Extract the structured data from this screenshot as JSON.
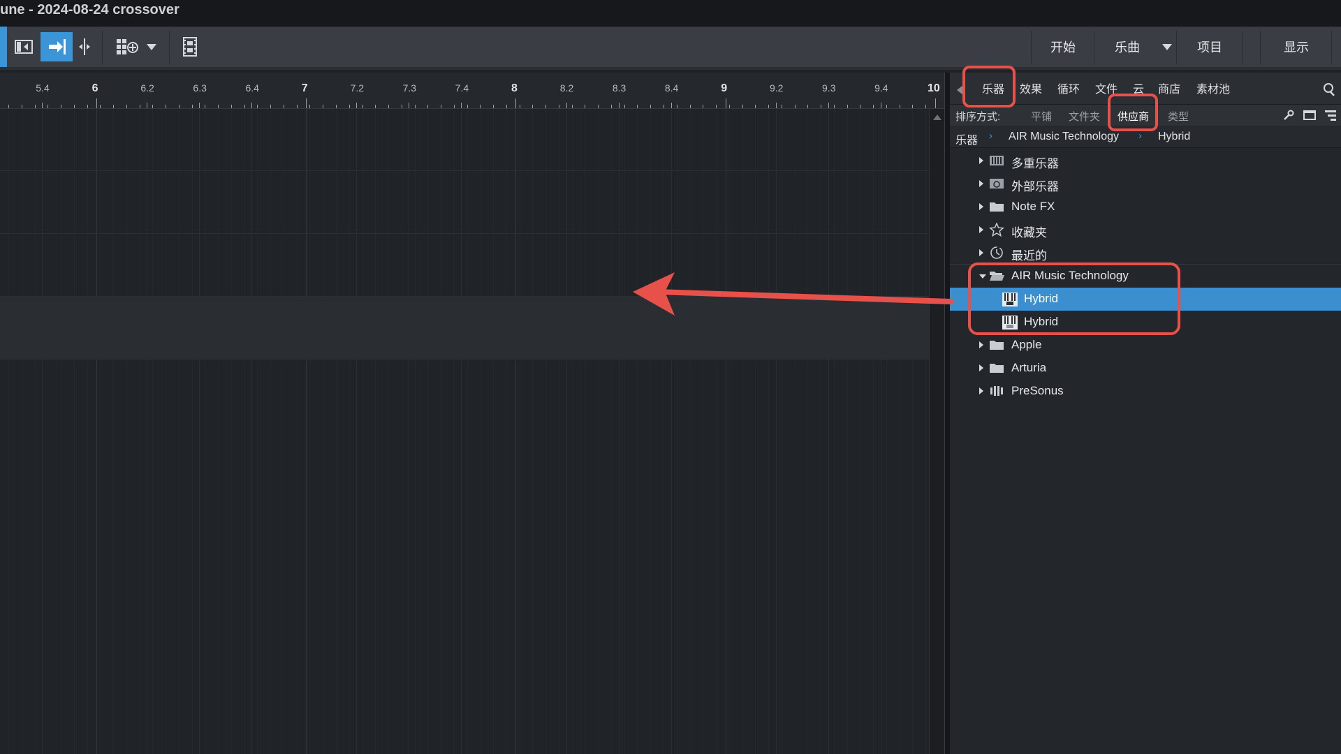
{
  "window": {
    "title": "une - 2024-08-24 crossover"
  },
  "toolbar": {
    "menus": [
      "开始",
      "乐曲",
      "项目",
      "显示"
    ]
  },
  "ruler": {
    "labels": [
      {
        "text": "5.4",
        "major": false
      },
      {
        "text": "6",
        "major": true
      },
      {
        "text": "6.2",
        "major": false
      },
      {
        "text": "6.3",
        "major": false
      },
      {
        "text": "6.4",
        "major": false
      },
      {
        "text": "7",
        "major": true
      },
      {
        "text": "7.2",
        "major": false
      },
      {
        "text": "7.3",
        "major": false
      },
      {
        "text": "7.4",
        "major": false
      },
      {
        "text": "8",
        "major": true
      },
      {
        "text": "8.2",
        "major": false
      },
      {
        "text": "8.3",
        "major": false
      },
      {
        "text": "8.4",
        "major": false
      },
      {
        "text": "9",
        "major": true
      },
      {
        "text": "9.2",
        "major": false
      },
      {
        "text": "9.3",
        "major": false
      },
      {
        "text": "9.4",
        "major": false
      },
      {
        "text": "10",
        "major": true
      }
    ]
  },
  "browser": {
    "tabs": [
      "乐器",
      "效果",
      "循环",
      "文件",
      "云",
      "商店",
      "素材池"
    ],
    "active_tab": "乐器",
    "sort": {
      "label": "排序方式:",
      "options": [
        "平铺",
        "文件夹",
        "供应商",
        "类型"
      ],
      "active": "供应商"
    },
    "breadcrumb": [
      "乐器",
      "AIR Music Technology",
      "Hybrid"
    ],
    "tree": [
      {
        "label": "多重乐器",
        "icon": "multi-instrument-icon",
        "expanded": false,
        "level": 0
      },
      {
        "label": "外部乐器",
        "icon": "external-instrument-icon",
        "expanded": false,
        "level": 0
      },
      {
        "label": "Note FX",
        "icon": "folder-icon",
        "expanded": false,
        "level": 0
      },
      {
        "label": "收藏夹",
        "icon": "star-icon",
        "expanded": false,
        "level": 0
      },
      {
        "label": "最近的",
        "icon": "clock-icon",
        "expanded": false,
        "level": 0
      },
      {
        "label": "AIR Music Technology",
        "icon": "open-folder-icon",
        "expanded": true,
        "level": 0
      },
      {
        "label": "Hybrid",
        "icon": "vst-instrument-icon",
        "level": 1,
        "selected": true
      },
      {
        "label": "Hybrid",
        "icon": "au-instrument-icon",
        "level": 1,
        "selected": false
      },
      {
        "label": "Apple",
        "icon": "folder-icon",
        "expanded": false,
        "level": 0
      },
      {
        "label": "Arturia",
        "icon": "folder-icon",
        "expanded": false,
        "level": 0
      },
      {
        "label": "PreSonus",
        "icon": "presonus-icon",
        "expanded": false,
        "level": 0
      }
    ]
  },
  "colors": {
    "accent": "#3c95d6",
    "annotation": "#e8504a"
  }
}
